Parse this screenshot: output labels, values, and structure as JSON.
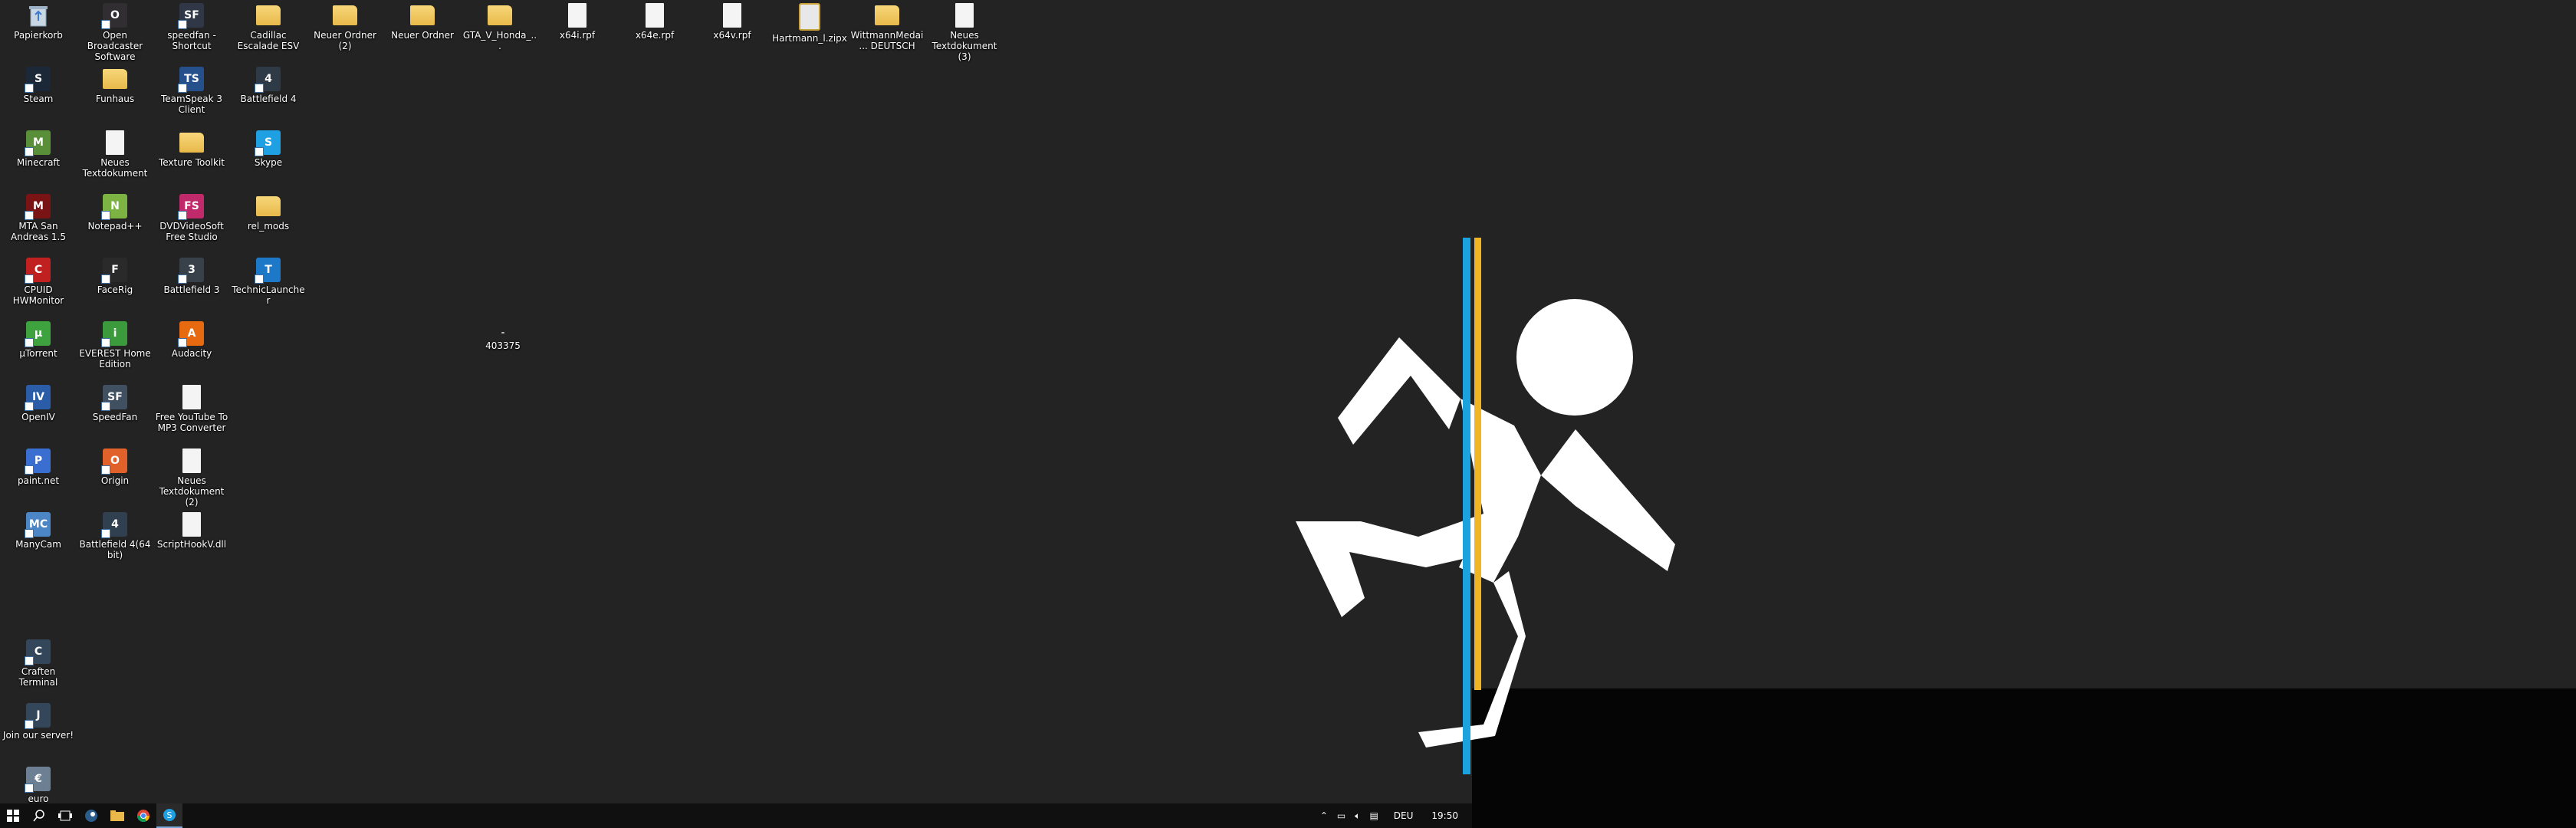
{
  "desktop": {
    "columns": [
      [
        {
          "label": "Papierkorb",
          "icon": "recycle-bin-icon",
          "kind": "bin"
        },
        {
          "label": "Steam",
          "icon": "steam-icon",
          "kind": "app",
          "color": "#1b2838",
          "glyph": "S"
        },
        {
          "label": "Minecraft",
          "icon": "minecraft-icon",
          "kind": "app",
          "color": "#5a8f3a",
          "glyph": "M"
        },
        {
          "label": "MTA San Andreas 1.5",
          "icon": "mta-icon",
          "kind": "app",
          "color": "#7a1414",
          "glyph": "M"
        },
        {
          "label": "CPUID HWMonitor",
          "icon": "hwmonitor-icon",
          "kind": "app",
          "color": "#c02020",
          "glyph": "C"
        },
        {
          "label": "µTorrent",
          "icon": "utorrent-icon",
          "kind": "app",
          "color": "#3ea33e",
          "glyph": "µ"
        },
        {
          "label": "OpenIV",
          "icon": "openiv-icon",
          "kind": "app",
          "color": "#2a5ca8",
          "glyph": "IV"
        },
        {
          "label": "paint.net",
          "icon": "paintnet-icon",
          "kind": "app",
          "color": "#3a6ed0",
          "glyph": "P"
        },
        {
          "label": "ManyCam",
          "icon": "manycam-icon",
          "kind": "app",
          "color": "#4c86c6",
          "glyph": "MC"
        }
      ],
      [
        {
          "label": "Open Broadcaster Software",
          "icon": "obs-icon",
          "kind": "app",
          "color": "#302e31",
          "glyph": "O"
        },
        {
          "label": "Funhaus",
          "icon": "folder-icon",
          "kind": "folder"
        },
        {
          "label": "Neues Textdokument",
          "icon": "text-document-icon",
          "kind": "doc"
        },
        {
          "label": "Notepad++",
          "icon": "notepadpp-icon",
          "kind": "app",
          "color": "#7cb342",
          "glyph": "N"
        },
        {
          "label": "FaceRig",
          "icon": "facerig-icon",
          "kind": "app",
          "color": "#2a2a2a",
          "glyph": "F"
        },
        {
          "label": "EVEREST Home Edition",
          "icon": "everest-icon",
          "kind": "app",
          "color": "#3b9a3b",
          "glyph": "i"
        },
        {
          "label": "SpeedFan",
          "icon": "speedfan-icon",
          "kind": "app",
          "color": "#405060",
          "glyph": "SF"
        },
        {
          "label": "Origin",
          "icon": "origin-icon",
          "kind": "app",
          "color": "#e0622a",
          "glyph": "O"
        },
        {
          "label": "Battlefield 4(64 bit)",
          "icon": "battlefield4-64-icon",
          "kind": "app",
          "color": "#304050",
          "glyph": "4"
        }
      ],
      [
        {
          "label": "speedfan - Shortcut",
          "icon": "speedfan-shortcut-icon",
          "kind": "app",
          "color": "#303848",
          "glyph": "SF"
        },
        {
          "label": "TeamSpeak 3 Client",
          "icon": "teamspeak-icon",
          "kind": "app",
          "color": "#26508c",
          "glyph": "TS"
        },
        {
          "label": "Texture Toolkit",
          "icon": "folder-icon",
          "kind": "folder"
        },
        {
          "label": "DVDVideoSoft Free Studio",
          "icon": "dvdvideosoft-icon",
          "kind": "app",
          "color": "#c02a6a",
          "glyph": "FS"
        },
        {
          "label": "Battlefield 3",
          "icon": "battlefield3-icon",
          "kind": "app",
          "color": "#38414a",
          "glyph": "3"
        },
        {
          "label": "Audacity",
          "icon": "audacity-icon",
          "kind": "app",
          "color": "#e86a10",
          "glyph": "A"
        },
        {
          "label": "Free YouTube To MP3 Converter",
          "icon": "youtube-mp3-icon",
          "kind": "doc"
        },
        {
          "label": "Neues Textdokument (2)",
          "icon": "text-document-icon",
          "kind": "doc"
        },
        {
          "label": "ScriptHookV.dll",
          "icon": "dll-file-icon",
          "kind": "doc"
        }
      ],
      [
        {
          "label": "Cadillac Escalade ESV",
          "icon": "folder-icon",
          "kind": "folder"
        },
        {
          "label": "Battlefield 4",
          "icon": "battlefield4-icon",
          "kind": "app",
          "color": "#2e3a46",
          "glyph": "4"
        },
        {
          "label": "Skype",
          "icon": "skype-icon",
          "kind": "app",
          "color": "#1fa0e3",
          "glyph": "S"
        },
        {
          "label": "rel_mods",
          "icon": "folder-icon",
          "kind": "folder"
        },
        {
          "label": "TechnicLauncher",
          "icon": "technic-icon",
          "kind": "app",
          "color": "#1d78c8",
          "glyph": "T"
        }
      ]
    ],
    "top_row": [
      {
        "label": "Neuer Ordner (2)",
        "icon": "folder-icon",
        "kind": "folder"
      },
      {
        "label": "Neuer Ordner",
        "icon": "folder-icon",
        "kind": "folder"
      },
      {
        "label": "GTA_V_Honda_...",
        "icon": "folder-icon",
        "kind": "folder"
      },
      {
        "label": "x64i.rpf",
        "icon": "rpf-file-icon",
        "kind": "doc"
      },
      {
        "label": "x64e.rpf",
        "icon": "rpf-file-icon",
        "kind": "doc"
      },
      {
        "label": "x64v.rpf",
        "icon": "rpf-file-icon",
        "kind": "doc"
      },
      {
        "label": "Hartmann_l.zipx",
        "icon": "zip-file-icon",
        "kind": "zip"
      },
      {
        "label": "WittmannMedai... DEUTSCH",
        "icon": "folder-icon",
        "kind": "folder"
      },
      {
        "label": "Neues Textdokument (3)",
        "icon": "text-document-icon",
        "kind": "doc"
      }
    ],
    "loose": [
      {
        "label": "403375",
        "icon": "small-file-icon",
        "kind": "tiny"
      }
    ],
    "bottom": [
      {
        "label": "Craften Terminal",
        "icon": "craften-icon",
        "kind": "app",
        "color": "#33465a",
        "glyph": "C"
      },
      {
        "label": "Join our server!",
        "icon": "join-server-icon",
        "kind": "app",
        "color": "#33465a",
        "glyph": "J"
      },
      {
        "label": "euro",
        "icon": "image-file-icon",
        "kind": "app",
        "color": "#6d7f93",
        "glyph": "€"
      }
    ]
  },
  "taskbar": {
    "language": "DEU",
    "time": "19:50",
    "pinned": [
      "start-icon",
      "search-icon",
      "task-view-icon",
      "steam-icon",
      "file-explorer-icon",
      "chrome-icon",
      "skype-icon"
    ]
  },
  "colors": {
    "desktop": "#232323",
    "portal_blue": "#1ba3e0",
    "portal_orange": "#f1b523",
    "figure": "#ffffff"
  }
}
